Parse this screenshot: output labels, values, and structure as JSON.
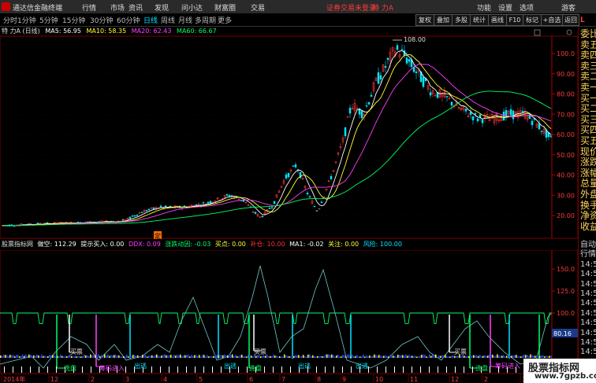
{
  "titlebar": {
    "app_name": "通达信金融终端",
    "menus": [
      "行情",
      "市场",
      "资讯",
      "发现",
      "问小达",
      "财富圈",
      "交易"
    ],
    "alert": "证券交易未登录",
    "stock_name": "特 力A",
    "right": [
      "功能",
      "设置",
      "选项"
    ],
    "guest": "游客"
  },
  "periods": {
    "items": [
      "分时",
      "1分钟",
      "5分钟",
      "15分钟",
      "30分钟",
      "60分钟",
      "日线",
      "周线",
      "月线",
      "多周期",
      "更多"
    ],
    "active": "日线",
    "right_tabs": [
      "复权",
      "叠加",
      "多股",
      "统计",
      "画线",
      "F10",
      "标记",
      "+自选",
      "返回"
    ]
  },
  "main_header": {
    "stock": "特 力A (日线)",
    "ma5": "MA5: 56.95",
    "ma10": "MA10: 58.35",
    "ma20": "MA20: 62.43",
    "ma60": "MA60: 66.67"
  },
  "price_axis": [
    "100.0",
    "90.00",
    "80.00",
    "70.00",
    "60.00",
    "50.00",
    "40.00",
    "30.00",
    "20.00"
  ],
  "peak_label": "108.00",
  "ding_label": "定",
  "sub_header": {
    "name": "股票指标网",
    "items": [
      {
        "text": "做空: 112.29",
        "color": "#ffffff"
      },
      {
        "text": "提示买入: 0.00",
        "color": "#ffffff"
      },
      {
        "text": "DDX: 0.09",
        "color": "#ff40ff"
      },
      {
        "text": "涨跌动因: -0.03",
        "color": "#00ff66"
      },
      {
        "text": "买点: 0.00",
        "color": "#ffff33"
      },
      {
        "text": "补仓: 10.00",
        "color": "#ff3030"
      },
      {
        "text": "MA1: -0.02",
        "color": "#ffffff"
      },
      {
        "text": "关注: 0.00",
        "color": "#ffff33"
      },
      {
        "text": "风险: 100.00",
        "color": "#00e5ff"
      }
    ]
  },
  "sub_axis": [
    "150.0",
    "125.0",
    "100.0",
    "80.16"
  ],
  "labels": {
    "buy": "买票",
    "chip": "筹码进入",
    "wash": "洗盘",
    "escape": "出逃"
  },
  "dates": [
    "2014年",
    "12",
    "2",
    "3",
    "4",
    "5",
    "6",
    "7",
    "8",
    "9",
    "10",
    "11",
    "12",
    "2",
    "3"
  ],
  "right_panel": {
    "top_icons": "L",
    "items": [
      "委比",
      "卖五",
      "卖四",
      "卖三",
      "卖二",
      "卖一",
      "买一",
      "买二",
      "买三",
      "买四",
      "买五",
      "现价",
      "涨跌",
      "涨幅",
      "总量",
      "外盘",
      "换手",
      "净资",
      "收益"
    ],
    "bottom": [
      "自动",
      "行情",
      "14:50",
      "14:50",
      "14:50",
      "14:50",
      "14:50",
      "14:50",
      "14:50",
      "14:50",
      "14:50",
      "14:5"
    ]
  },
  "watermark": {
    "title": "股票指标网",
    "url": "www.7gpzb.com"
  },
  "colors": {
    "ma5": "#ffffff",
    "ma10": "#ffff33",
    "ma20": "#ff40ff",
    "ma60": "#00ff66",
    "up": "#ff3b3b",
    "down": "#00e5ff"
  }
}
